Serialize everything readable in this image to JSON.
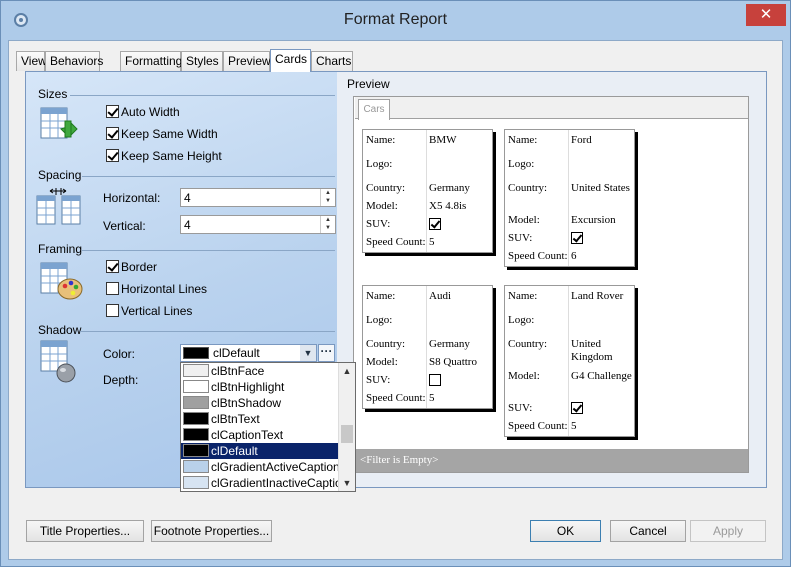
{
  "window": {
    "title": "Format Report",
    "close": "✕"
  },
  "tabs": [
    {
      "label": "View"
    },
    {
      "label": "Behaviors"
    },
    {
      "label": "Formatting"
    },
    {
      "label": "Styles"
    },
    {
      "label": "Preview"
    },
    {
      "label": "Cards"
    },
    {
      "label": "Charts"
    }
  ],
  "active_tab": "Cards",
  "sizes": {
    "header": "Sizes",
    "auto_width": {
      "label": "Auto Width",
      "checked": true
    },
    "keep_same_width": {
      "label": "Keep Same Width",
      "checked": true
    },
    "keep_same_height": {
      "label": "Keep Same Height",
      "checked": true
    }
  },
  "spacing": {
    "header": "Spacing",
    "horizontal": {
      "label": "Horizontal:",
      "value": "4"
    },
    "vertical": {
      "label": "Vertical:",
      "value": "4"
    }
  },
  "framing": {
    "header": "Framing",
    "border": {
      "label": "Border",
      "checked": true
    },
    "horizontal_lines": {
      "label": "Horizontal Lines",
      "checked": false
    },
    "vertical_lines": {
      "label": "Vertical Lines",
      "checked": false
    }
  },
  "shadow": {
    "header": "Shadow",
    "color_label": "Color:",
    "color_value": "clDefault",
    "depth_label": "Depth:",
    "ellipsis": "···"
  },
  "color_options": [
    {
      "name": "clBtnFace",
      "swatch": "#f0f0f0"
    },
    {
      "name": "clBtnHighlight",
      "swatch": "#ffffff"
    },
    {
      "name": "clBtnShadow",
      "swatch": "#a0a0a0"
    },
    {
      "name": "clBtnText",
      "swatch": "#000000"
    },
    {
      "name": "clCaptionText",
      "swatch": "#000000"
    },
    {
      "name": "clDefault",
      "swatch": "#000000",
      "selected": true
    },
    {
      "name": "clGradientActiveCaption",
      "swatch": "#b9d1ea"
    },
    {
      "name": "clGradientInactiveCaption",
      "swatch": "#d7e4f2"
    }
  ],
  "preview": {
    "label": "Preview",
    "tab": "Cars",
    "filter_text": "<Filter is Empty>",
    "field_labels": {
      "name": "Name:",
      "logo": "Logo:",
      "country": "Country:",
      "model": "Model:",
      "suv": "SUV:",
      "speed": "Speed Count:"
    },
    "cards": [
      {
        "name": "BMW",
        "country": "Germany",
        "model": "X5 4.8is",
        "suv": true,
        "speed": "5"
      },
      {
        "name": "Ford",
        "country": "United States",
        "model": "Excursion",
        "suv": true,
        "speed": "6"
      },
      {
        "name": "Audi",
        "country": "Germany",
        "model": "S8 Quattro",
        "suv": false,
        "speed": "5"
      },
      {
        "name": "Land Rover",
        "country": "United Kingdom",
        "model": "G4 Challenge",
        "suv": true,
        "speed": "5"
      }
    ]
  },
  "buttons": {
    "title_props": "Title Properties...",
    "footnote_props": "Footnote Properties...",
    "ok": "OK",
    "cancel": "Cancel",
    "apply": "Apply"
  }
}
